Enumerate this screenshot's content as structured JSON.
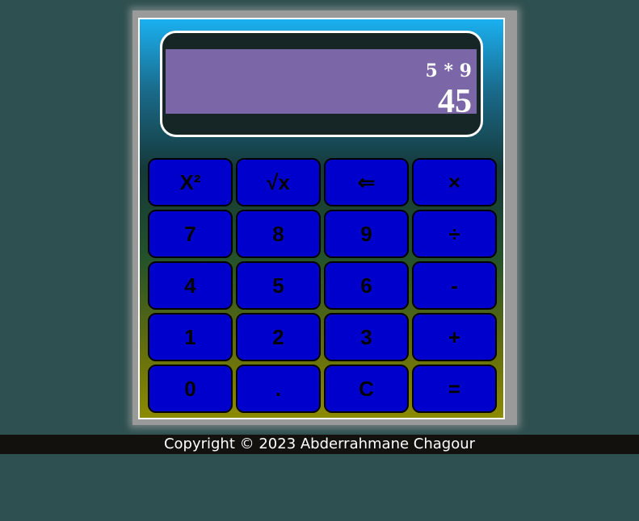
{
  "display": {
    "expression": "5 * 9",
    "result": "45"
  },
  "keys": [
    {
      "label": "X²",
      "name": "square-key"
    },
    {
      "label": "√x",
      "name": "sqrt-key"
    },
    {
      "label": "⇐",
      "name": "backspace-key"
    },
    {
      "label": "×",
      "name": "multiply-key"
    },
    {
      "label": "7",
      "name": "digit-7-key"
    },
    {
      "label": "8",
      "name": "digit-8-key"
    },
    {
      "label": "9",
      "name": "digit-9-key"
    },
    {
      "label": "÷",
      "name": "divide-key"
    },
    {
      "label": "4",
      "name": "digit-4-key"
    },
    {
      "label": "5",
      "name": "digit-5-key"
    },
    {
      "label": "6",
      "name": "digit-6-key"
    },
    {
      "label": "-",
      "name": "subtract-key"
    },
    {
      "label": "1",
      "name": "digit-1-key"
    },
    {
      "label": "2",
      "name": "digit-2-key"
    },
    {
      "label": "3",
      "name": "digit-3-key"
    },
    {
      "label": "+",
      "name": "add-key"
    },
    {
      "label": "0",
      "name": "digit-0-key"
    },
    {
      "label": ".",
      "name": "decimal-key"
    },
    {
      "label": "C",
      "name": "clear-key"
    },
    {
      "label": "=",
      "name": "equals-key"
    }
  ],
  "footer": {
    "copyright": "Copyright © 2023 Abderrahmane Chagour"
  },
  "colors": {
    "background": "#2f5050",
    "key": "#0000cc",
    "screen": "#7b67a8",
    "footer": "#12110d"
  }
}
